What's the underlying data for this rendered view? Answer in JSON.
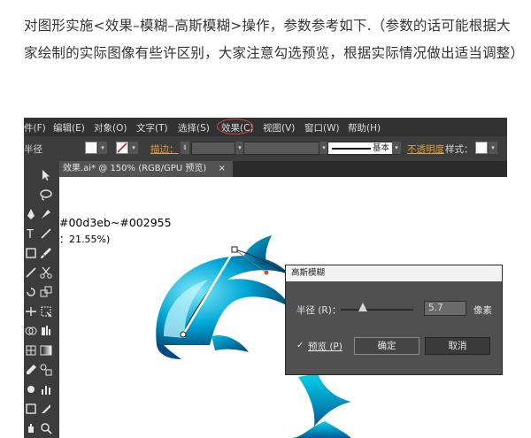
{
  "article": {
    "paragraph": "对图形实施<效果–模糊–高斯模糊>操作，参数参考如下.（参数的话可能根据大家绘制的实际图像有些许区别，大家注意勾选预览，根据实际情况做出适当调整）"
  },
  "menubar": {
    "items": [
      "件(F)",
      "编辑(E)",
      "对象(O)",
      "文字(T)",
      "选择(S)",
      "效果(C)",
      "视图(V)",
      "窗口(W)",
      "帮助(H)"
    ]
  },
  "control_bar": {
    "left_label": "半径",
    "stroke_label": "描边：",
    "stroke_stepper": "⇕",
    "line_style": "基本",
    "opacity_label": "不透明度",
    "style_label": "样式："
  },
  "document_tab": {
    "title": "效果.ai* @ 150% (RGB/GPU 预览)",
    "close": "×"
  },
  "canvas": {
    "gradient_note": "#00d3eb~#002955",
    "percent_note": "：21.55%)"
  },
  "gaussian_dialog": {
    "title": "高斯模糊",
    "radius_label": "半径 (R)：",
    "radius_value": "5.7",
    "unit": "像素",
    "radius_fraction": 0.3,
    "preview_check": "✓",
    "preview_label": "预览 (P)",
    "ok_label": "确定",
    "cancel_label": "取消"
  },
  "colors": {
    "menu_bg": "#323232",
    "panel_bg": "#3c3c3c",
    "dialog_bg": "#505050",
    "accent_red": "#d0473c",
    "dolphin_light": "#00d3eb",
    "dolphin_dark": "#002955"
  }
}
